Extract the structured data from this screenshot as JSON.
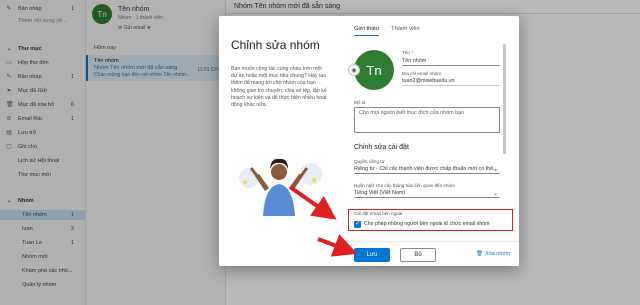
{
  "sidebar": {
    "items": [
      {
        "label": "Bản nháp",
        "count": "1",
        "icon": "pencil-icon"
      },
      {
        "label": "Thêm nội dung yê...",
        "count": "",
        "icon": ""
      },
      {
        "label": "Thư mục",
        "count": "",
        "icon": "chevron-down-icon"
      },
      {
        "label": "Hộp thư đến",
        "count": "",
        "icon": "inbox-icon"
      },
      {
        "label": "Bản nháp",
        "count": "1",
        "icon": "pencil-icon"
      },
      {
        "label": "Mục đã Gửi",
        "count": "",
        "icon": "send-icon"
      },
      {
        "label": "Mục đã xóa bỏ",
        "count": "6",
        "icon": "trash-icon"
      },
      {
        "label": "Email Rác",
        "count": "1",
        "icon": "junk-icon"
      },
      {
        "label": "Lưu trữ",
        "count": "",
        "icon": "archive-icon"
      },
      {
        "label": "Ghi chú",
        "count": "",
        "icon": "note-icon"
      },
      {
        "label": "Lịch sử Hội thoại",
        "count": "",
        "icon": ""
      },
      {
        "label": "Thư mục mới",
        "count": "",
        "icon": ""
      },
      {
        "label": "Nhóm",
        "count": "",
        "icon": "chevron-down-icon"
      },
      {
        "label": "Tên nhóm",
        "count": "1",
        "icon": ""
      },
      {
        "label": "tuan",
        "count": "2",
        "icon": ""
      },
      {
        "label": "Tuan Le",
        "count": "1",
        "icon": ""
      },
      {
        "label": "Nhóm mới",
        "count": "",
        "icon": ""
      },
      {
        "label": "Khám phá các nhó...",
        "count": "",
        "icon": ""
      },
      {
        "label": "Quản lý nhóm",
        "count": "",
        "icon": ""
      }
    ]
  },
  "group": {
    "avatar": "Tn",
    "name": "Tên nhóm",
    "meta": "Nhóm  ·  1 thành viên",
    "action": "✉ Gửi email   ★",
    "list_header": "Hôm nay"
  },
  "mail": {
    "sender": "Tên nhóm",
    "subject": "Nhóm Tên nhóm mới đã sẵn sàng",
    "preview": "Chào mừng bạn đến với nhóm Tên nhóm...",
    "time": "11:01 CH"
  },
  "reading": {
    "title": "Nhóm Tên nhóm mới đã sẵn sàng"
  },
  "dialog": {
    "title": "Chỉnh sửa nhóm",
    "description": "Bạn muốn cộng tác cùng nhau trên một dự án hoặc một mục tiêu chung? Hãy tạo thêm để mang tới cho nhóm của bạn không gian trò chuyện, chia sẻ tệp, lập kế hoạch sự kiện và để thực hiện nhiều hoạt động khác nữa.",
    "tabs": [
      "Giới thiệu",
      "Thành viên"
    ],
    "avatar": "Tn",
    "name_label": "Tên *",
    "name_value": "Tên nhóm",
    "email_label": "Địa chỉ email nhóm",
    "email_value": "tuan2@misebuedu.vn",
    "desc_label": "Mô tả",
    "desc_value": "Cho mọi người biết mục đích của nhóm bạn",
    "settings_title": "Chỉnh sửa cài đặt",
    "privacy_label": "Quyền riêng tư",
    "privacy_value": "Riêng tư - Chỉ các thành viên được chấp thuận mới có thể...",
    "lang_label": "Ngôn ngữ cho các thông báo liên quan đến nhóm",
    "lang_value": "Tiếng Việt (Việt Nam)",
    "ext_label": "Cài đặt email bên ngoài",
    "ext_checkbox": "Cho phép những người bên ngoài tổ chức email nhóm",
    "save": "Lưu",
    "cancel": "Bỏ",
    "delete": "Xóa nhóm"
  },
  "colors": {
    "accent": "#0078d4",
    "group_avatar": "#2e7d32",
    "annotation_red": "#e02020"
  }
}
